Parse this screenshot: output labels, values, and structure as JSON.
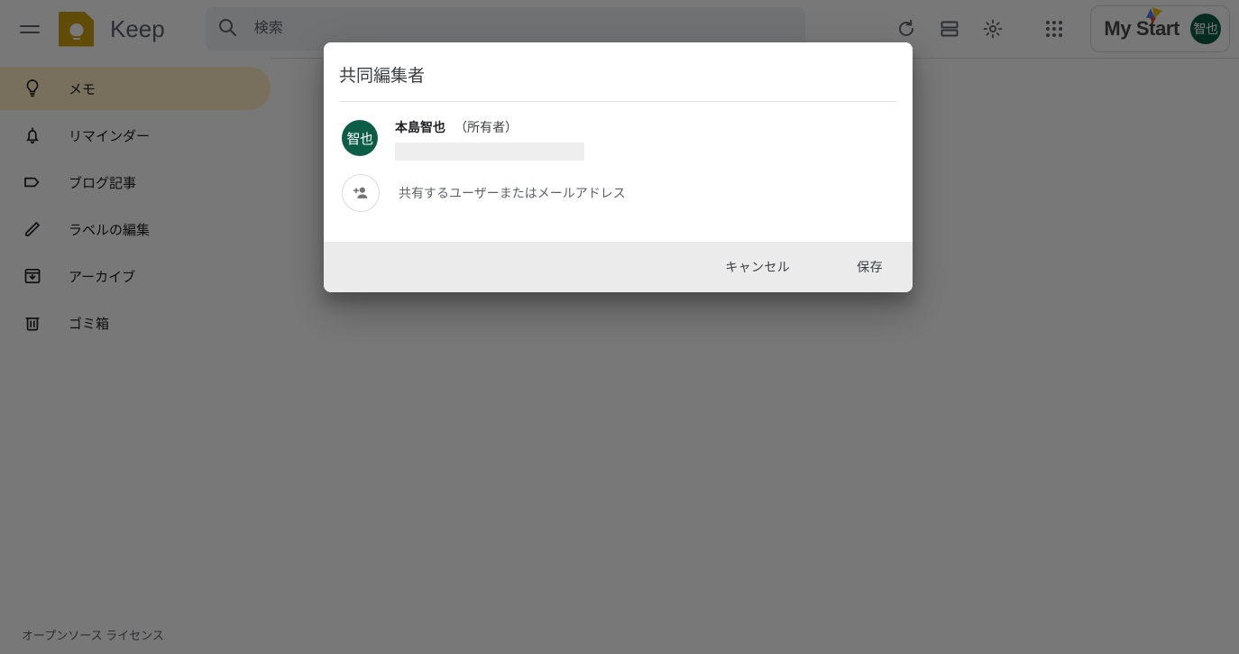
{
  "app": {
    "name": "Keep",
    "logo_color": "#cfa012"
  },
  "header": {
    "menu_icon": "hamburger-menu-icon",
    "brand_label": "Keep",
    "search": {
      "icon": "search-icon",
      "placeholder": "検索",
      "value": ""
    },
    "actions": [
      {
        "name": "refresh-button",
        "icon": "refresh-icon"
      },
      {
        "name": "list-view-button",
        "icon": "list-view-icon"
      },
      {
        "name": "settings-button",
        "icon": "gear-icon"
      },
      {
        "name": "apps-button",
        "icon": "apps-grid-icon"
      }
    ],
    "account_chip": {
      "brand_label": "My Start",
      "brand_mark": "mystart-triangles-logo",
      "brand_colors": [
        "#4285f4",
        "#fbbc05",
        "#ea4335"
      ],
      "avatar_initials": "智也",
      "avatar_color": "#0d5c46"
    }
  },
  "sidebar": {
    "items": [
      {
        "label": "メモ",
        "icon": "lightbulb-icon",
        "active": true
      },
      {
        "label": "リマインダー",
        "icon": "bell-icon",
        "active": false
      },
      {
        "label": "ブログ記事",
        "icon": "label-tag-icon",
        "active": false
      },
      {
        "label": "ラベルの編集",
        "icon": "pencil-icon",
        "active": false
      },
      {
        "label": "アーカイブ",
        "icon": "archive-icon",
        "active": false
      },
      {
        "label": "ゴミ箱",
        "icon": "trash-icon",
        "active": false
      }
    ],
    "active_color": "#feefc3",
    "footer_link": "オープンソース ライセンス"
  },
  "dialog": {
    "title": "共同編集者",
    "owner": {
      "avatar_initials": "智也",
      "avatar_color": "#0d5c46",
      "name": "本島智也",
      "role_tag": "（所有者）",
      "email_redacted": true
    },
    "share_row": {
      "icon": "person-add-icon",
      "placeholder": "共有するユーザーまたはメールアドレス",
      "value": ""
    },
    "buttons": {
      "cancel_label": "キャンセル",
      "save_label": "保存"
    }
  }
}
